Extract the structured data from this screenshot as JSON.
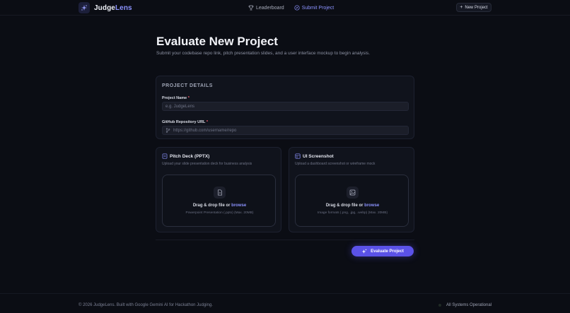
{
  "header": {
    "brand_prefix": "Judge",
    "brand_suffix": "Lens",
    "nav": [
      {
        "label": "Leaderboard",
        "icon": "trophy-icon",
        "active": false
      },
      {
        "label": "Submit Project",
        "icon": "compass-icon",
        "active": true
      }
    ],
    "new_project_label": "New Project"
  },
  "page": {
    "title": "Evaluate New Project",
    "subtitle": "Submit your codebase repo link, pitch presentation slides, and a user interface mockup to begin analysis."
  },
  "details": {
    "section_title": "PROJECT DETAILS",
    "project_name": {
      "label": "Project Name",
      "required_mark": "*",
      "placeholder": "e.g. JudgeLens",
      "value": ""
    },
    "repo_url": {
      "label": "GitHub Repository URL",
      "required_mark": "*",
      "placeholder": "https://github.com/username/repo",
      "value": ""
    }
  },
  "uploads": {
    "pitch": {
      "title": "Pitch Deck (PPTX)",
      "description": "Upload your slide presentation deck for business analysis",
      "drop_text": "Drag & drop file or ",
      "browse": "browse",
      "hint": "Powerpoint Presentation (.pptx) (Max. 20MB)"
    },
    "screenshot": {
      "title": "UI Screenshot",
      "description": "Upload a dashboard screenshot or wireframe mock",
      "drop_text": "Drag & drop file or ",
      "browse": "browse",
      "hint": "Image formats (.png, .jpg, .webp) (Max. 20MB)"
    }
  },
  "actions": {
    "evaluate_label": "Evaluate Project"
  },
  "footer": {
    "copyright": "© 2026 JudgeLens. Built with Google Gemini AI for Hackathon Judging.",
    "status": "All Systems Operational"
  },
  "colors": {
    "background": "#0b0d14",
    "accent": "#8c93ff",
    "button": "#5b52e8",
    "required": "#ff5b6e"
  }
}
